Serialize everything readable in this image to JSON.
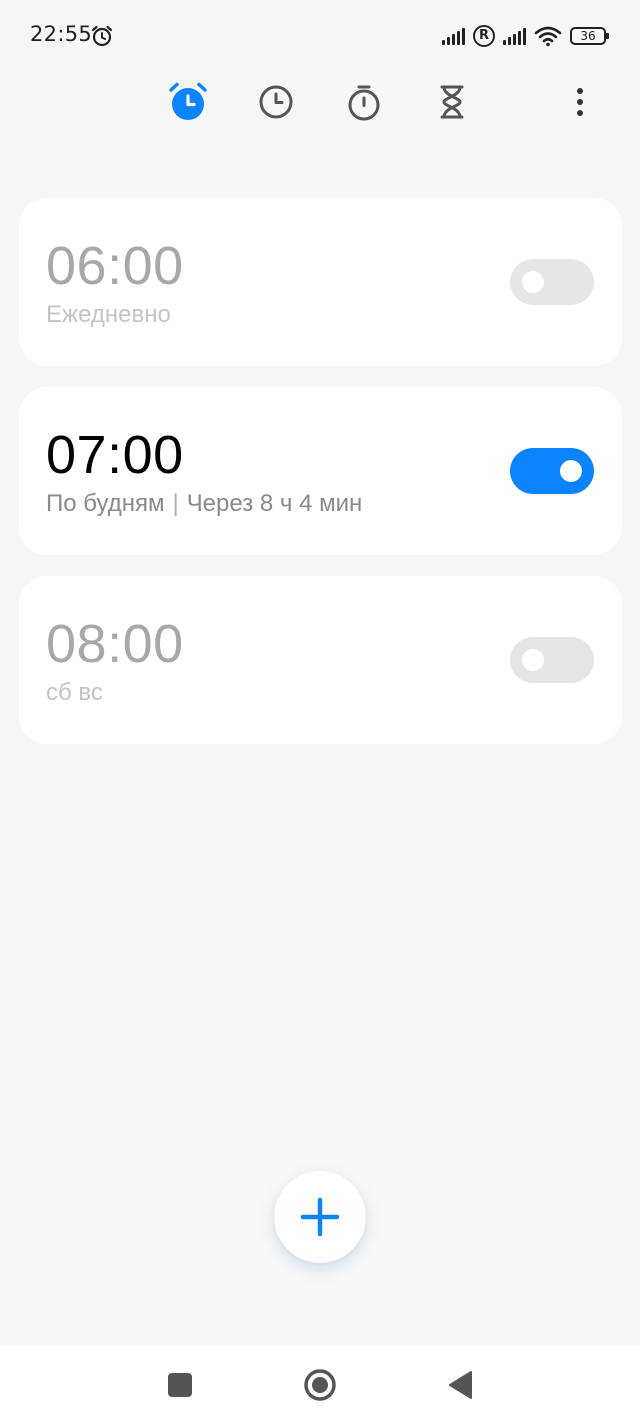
{
  "status_bar": {
    "time": "22:55",
    "battery": "36",
    "roaming": "R"
  },
  "tabs": [
    {
      "id": "alarm",
      "icon": "alarm-clock-icon",
      "active": true
    },
    {
      "id": "world-clock",
      "icon": "clock-icon",
      "active": false
    },
    {
      "id": "stopwatch",
      "icon": "stopwatch-icon",
      "active": false
    },
    {
      "id": "timer",
      "icon": "hourglass-icon",
      "active": false
    }
  ],
  "alarms": [
    {
      "time": "06:00",
      "repeat": "Ежедневно",
      "countdown": "",
      "enabled": false
    },
    {
      "time": "07:00",
      "repeat": "По будням",
      "separator": "|",
      "countdown": "Через 8 ч 4 мин",
      "enabled": true
    },
    {
      "time": "08:00",
      "repeat": "сб вс",
      "countdown": "",
      "enabled": false
    }
  ],
  "colors": {
    "accent": "#0d84ff",
    "background": "#f7f7f7",
    "card": "#ffffff",
    "toggle_off": "#e6e6e6"
  }
}
